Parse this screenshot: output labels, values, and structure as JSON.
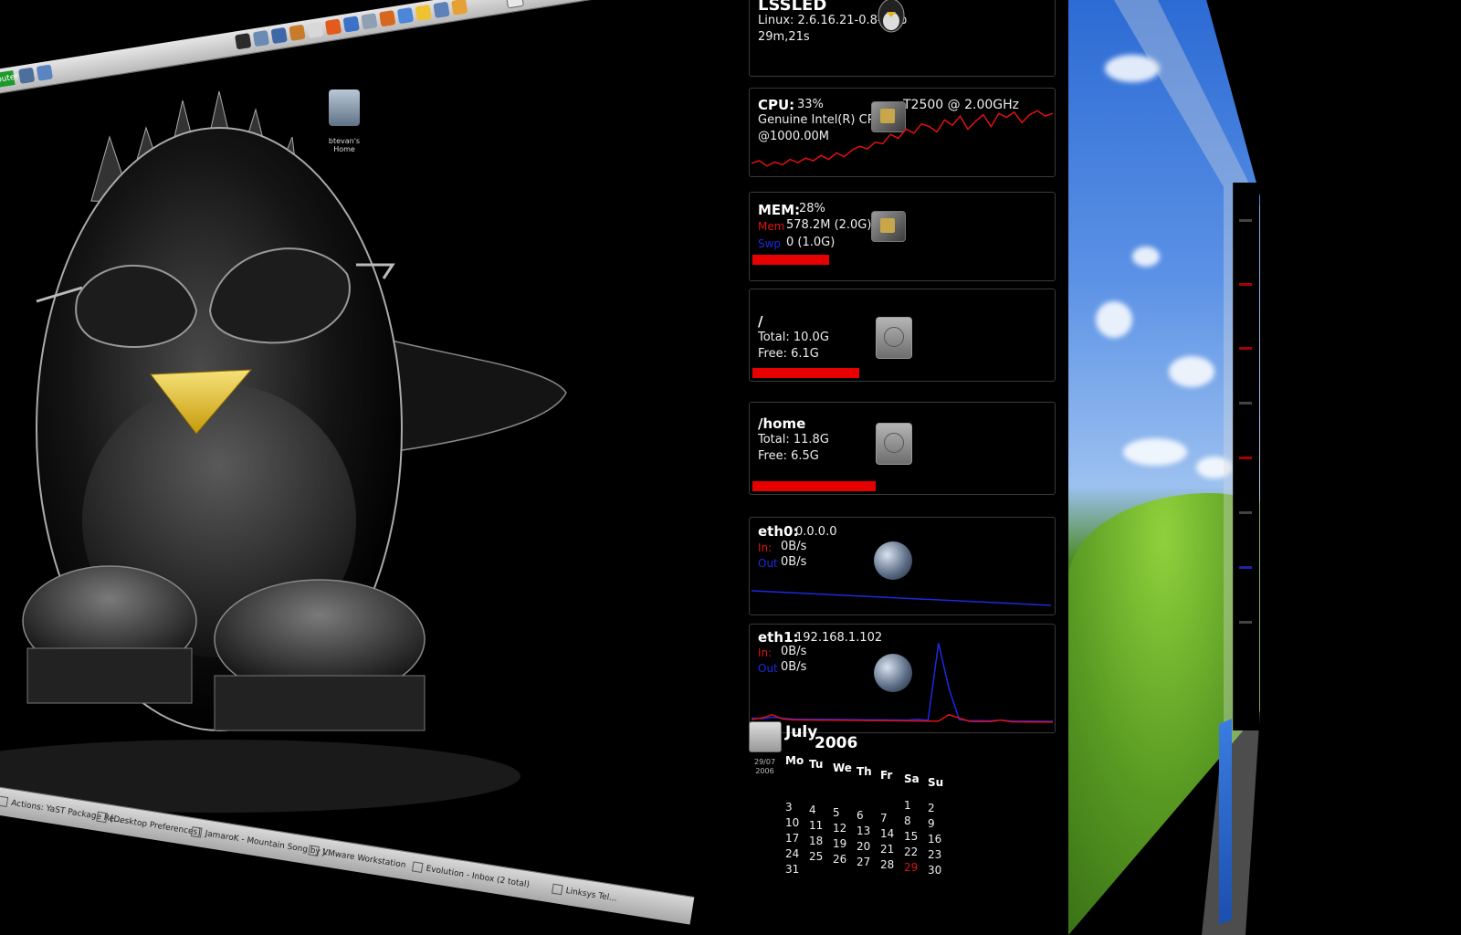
{
  "desktop": {
    "home_icon_label": "btevan's Home",
    "start_label": "Computer",
    "taskbar": [
      "Actions: YaST Package Re...",
      "[Desktop Preferences]",
      "JamaroK - Mountain Song by J...",
      "VMware Workstation",
      "Evolution - Inbox (2 total)",
      "Linksys Tel..."
    ]
  },
  "sysmon": {
    "host": {
      "hostname": "LSSLED",
      "kernel": "Linux: 2.6.16.21-0.8-smp",
      "uptime": "29m,21s"
    },
    "cpu": {
      "label": "CPU:",
      "percent": "33%",
      "model": "Genuine Intel(R) CPU",
      "model2": "T2500  @ 2.00GHz",
      "freq": "@1000.00M",
      "history": [
        14,
        18,
        10,
        16,
        12,
        20,
        15,
        22,
        18,
        26,
        20,
        30,
        24,
        34,
        40,
        36,
        46,
        44,
        58,
        52,
        66,
        60,
        74,
        70,
        62,
        80,
        72,
        86,
        66,
        78,
        88,
        70,
        90,
        84,
        92,
        76,
        88,
        94,
        86,
        90
      ]
    },
    "mem": {
      "label": "MEM:",
      "percent": "28%",
      "mem_label": "Mem",
      "mem_value": "578.2M (2.0G)",
      "swap_label": "Swp",
      "swap_value": "0 (1.0G)",
      "usage_fraction": 0.28
    },
    "root_fs": {
      "mount": "/",
      "total": "Total: 10.0G",
      "free": "Free: 6.1G",
      "used_fraction": 0.39
    },
    "home_fs": {
      "mount": "/home",
      "total": "Total: 11.8G",
      "free": "Free: 6.5G",
      "used_fraction": 0.45
    },
    "eth0": {
      "label": "eth0:",
      "ip": "0.0.0.0",
      "in_label": "In:",
      "in_value": "0B/s",
      "out_label": "Out",
      "out_value": "0B/s"
    },
    "eth1": {
      "label": "eth1:",
      "ip": "192.168.1.102",
      "in_label": "In:",
      "in_value": "0B/s",
      "out_label": "Out",
      "out_value": "0B/s",
      "in_history": [
        0,
        2,
        6,
        1,
        0,
        0,
        0,
        0,
        0,
        0,
        0,
        0,
        0,
        0,
        0,
        0,
        0,
        0,
        0,
        8,
        4,
        0,
        0,
        0,
        2,
        0,
        0,
        0,
        0,
        0
      ],
      "out_history": [
        2,
        1,
        3,
        2,
        1,
        1,
        1,
        1,
        1,
        1,
        1,
        1,
        1,
        1,
        1,
        1,
        2,
        1,
        95,
        40,
        2,
        1,
        1,
        1,
        2,
        1,
        1,
        1,
        1,
        1
      ]
    }
  },
  "calendar": {
    "icon_date": "29/07",
    "icon_year": "2006",
    "month": "July",
    "year": "2006",
    "weekdays": [
      "Mo",
      "Tu",
      "We",
      "Th",
      "Fr",
      "Sa",
      "Su"
    ],
    "weeks": [
      [
        "",
        "",
        "",
        "",
        "",
        "1",
        "2"
      ],
      [
        "3",
        "4",
        "5",
        "6",
        "7",
        "8",
        "9"
      ],
      [
        "10",
        "11",
        "12",
        "13",
        "14",
        "15",
        "16"
      ],
      [
        "17",
        "18",
        "19",
        "20",
        "21",
        "22",
        "23"
      ],
      [
        "24",
        "25",
        "26",
        "27",
        "28",
        "29",
        "30"
      ],
      [
        "31",
        "",
        "",
        "",
        "",
        "",
        ""
      ]
    ],
    "today": "29"
  },
  "colors": {
    "bar_red": "#e60000",
    "graph_red": "#e01010",
    "graph_blue": "#1c2ae0"
  }
}
